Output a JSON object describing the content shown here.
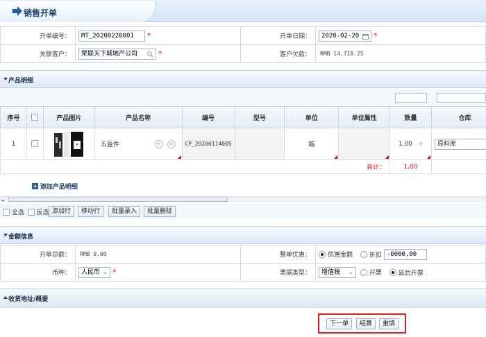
{
  "page": {
    "title": "销售开单"
  },
  "header": {
    "order_no": {
      "label": "开单编号：",
      "value": "MT_20200220001"
    },
    "order_date": {
      "label": "开单日期：",
      "value": "2020-02-20"
    },
    "customer": {
      "label": "关联客户：",
      "value": "荣联天下城地产公司"
    },
    "debt": {
      "label": "客户欠款：",
      "value": "RMB 14,718.25"
    }
  },
  "products": {
    "section_title": "产品明细",
    "columns": [
      "序号",
      "产品图片",
      "产品名称",
      "编号",
      "型号",
      "单位",
      "单位属性",
      "数量",
      "仓库"
    ],
    "rows": [
      {
        "index": "1",
        "name": "五金件",
        "code": "CP_20200114005",
        "model": "",
        "unit": "箱",
        "unit_attr": "",
        "qty": "1.00",
        "warehouse": "原料库"
      }
    ],
    "total_label": "合计：",
    "total_value": "1.00",
    "add_label": "添加产品明细",
    "select_all": "全选",
    "invert": "反选",
    "buttons": [
      "添加行",
      "移动行",
      "批量录入",
      "批量删除"
    ]
  },
  "amount": {
    "section_title": "金额信息",
    "total": {
      "label": "开单总额：",
      "value": "RMB 0.00"
    },
    "discount": {
      "label": "整单优惠：",
      "opt1": "优惠金额",
      "opt2": "折扣",
      "value": "-6000.00"
    },
    "currency": {
      "label": "币种：",
      "value": "人民币"
    },
    "invoice": {
      "label": "票据类型：",
      "value": "增值税",
      "opt1": "开票",
      "opt2": "延后开票"
    }
  },
  "shipping": {
    "section_title": "收货地址/概要"
  },
  "actions": {
    "next": "下一单",
    "settle": "结算",
    "reset": "重填"
  },
  "colors": {
    "accent": "#1f5aa8",
    "required": "#e00000",
    "highlight_box": "#e02020"
  },
  "icons": [
    "arrow-right-icon",
    "calendar-icon",
    "search-icon",
    "add-icon",
    "remove-icon",
    "checkbox-icon",
    "radio-icon",
    "chevron-down-icon",
    "add-product-icon"
  ]
}
